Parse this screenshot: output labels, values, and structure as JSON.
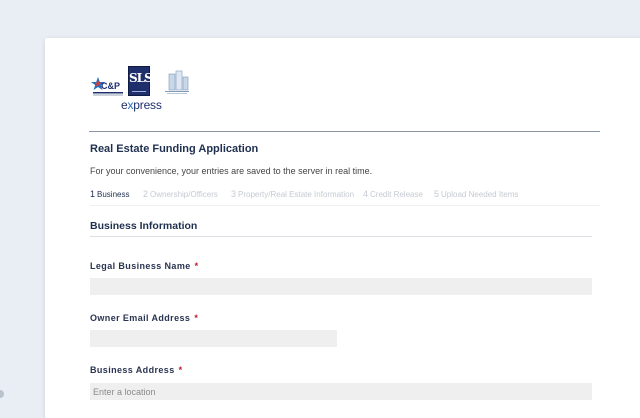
{
  "logos": {
    "cp_text": "C&P",
    "sls_text": "SLS",
    "express_prefix": "e",
    "express_x": "x",
    "express_suffix": "press"
  },
  "form": {
    "title": "Real Estate Funding Application",
    "subtitle": "For your convenience, your entries are saved to the server in real time.",
    "steps": [
      {
        "num": "1",
        "label": "Business",
        "active": true
      },
      {
        "num": "2",
        "label": "Ownership/Officers",
        "active": false
      },
      {
        "num": "3",
        "label": "Property/Real Estate Information",
        "active": false
      },
      {
        "num": "4",
        "label": "Credit Release",
        "active": false
      },
      {
        "num": "5",
        "label": "Upload Needed Items",
        "active": false
      }
    ],
    "section_title": "Business Information",
    "fields": [
      {
        "label": "Legal Business Name",
        "required": "*",
        "value": "",
        "placeholder": ""
      },
      {
        "label": "Owner Email Address",
        "required": "*",
        "value": "",
        "placeholder": ""
      },
      {
        "label": "Business Address",
        "required": "*",
        "value": "",
        "placeholder": "Enter a location"
      }
    ]
  },
  "colors": {
    "background": "#e9eef4",
    "card": "#ffffff",
    "title": "#1f2f4f",
    "required": "#c0172e",
    "input_bg": "#efefef",
    "step_inactive": "#c5cad2"
  }
}
